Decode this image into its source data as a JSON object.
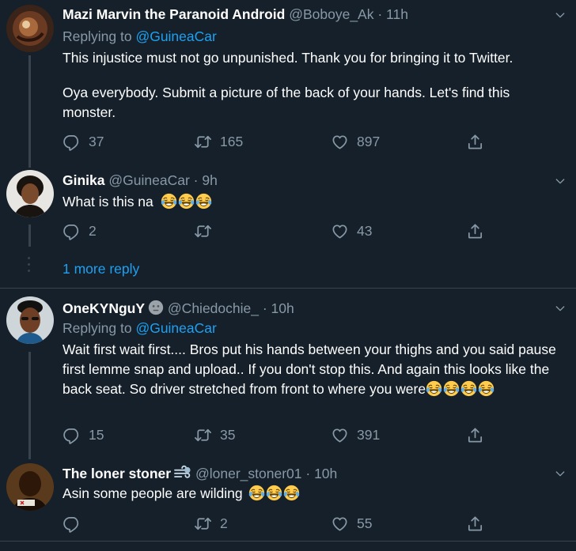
{
  "colors": {
    "background": "#15202b",
    "text_primary": "#ffffff",
    "text_secondary": "#8899a6",
    "accent": "#1da1f2",
    "divider": "#38444d"
  },
  "tweets": [
    {
      "display_name": "Mazi Marvin the Paranoid Android",
      "handle": "@Boboye_Ak",
      "time": "· 11h",
      "replying_prefix": "Replying to",
      "replying_to": "@GuineaCar",
      "text_line1": "This injustice must not go unpunished. Thank you for bringing it to Twitter.",
      "text_line2": "Oya everybody. Submit a picture of the back of your hands. Let's find this monster.",
      "replies": "37",
      "retweets": "165",
      "likes": "897"
    },
    {
      "display_name": "Ginika",
      "handle": "@GuineaCar",
      "time": "· 9h",
      "text": "What is this na",
      "emoji_count": 3,
      "replies": "2",
      "retweets": "",
      "likes": "43"
    },
    {
      "display_name": "OneKYNguY",
      "handle": "@Chiedochie_",
      "time": "· 10h",
      "replying_prefix": "Replying to",
      "replying_to": "@GuineaCar",
      "text": "Wait first wait first.... Bros put his hands between your thighs and you said pause first lemme snap and upload.. If you don't stop this. And again this looks like the back seat. So driver stretched from front to where you were",
      "emoji_count": 4,
      "replies": "15",
      "retweets": "35",
      "likes": "391"
    },
    {
      "display_name": "The loner stoner",
      "handle": "@loner_stoner01",
      "time": "· 10h",
      "text": "Asin some people are wilding",
      "emoji_count": 3,
      "replies": "",
      "retweets": "2",
      "likes": "55"
    }
  ],
  "more_replies": "1 more reply",
  "icons": {
    "reply": "reply-icon",
    "retweet": "retweet-icon",
    "like": "like-icon",
    "share": "share-icon",
    "caret": "chevron-down-icon",
    "emoji": "face-with-tears-of-joy-icon",
    "name_emoji_1": "neutral-face-icon",
    "name_emoji_2": "wind-blowing-icon"
  }
}
